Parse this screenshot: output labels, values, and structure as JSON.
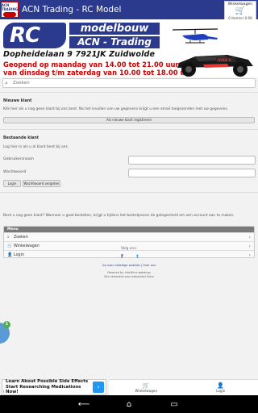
{
  "app": {
    "title": "ACN Trading - RC Model",
    "icon_text": "ACN TRADING"
  },
  "cart_widget": {
    "label": "Winkelwagen",
    "price": "0 item(s) 0,00",
    "icon": "cart-icon"
  },
  "banner": {
    "rc": "RC",
    "modelbouw": "modelbouw",
    "acn": "ACN - Trading",
    "address": "Dopheidelaan 9    7921JK    Zuidwolde",
    "open_line1": "Geopend op maandag van 14.00 tot 21.00 uur",
    "open_line2": "van dinsdag t/m zaterdag van 10.00 tot 18.00 uur",
    "car_text": "OVER X"
  },
  "search": {
    "placeholder": "Zoeken"
  },
  "new_customer": {
    "title": "Nieuwe klant",
    "text": "Klik hier als u nog geen klant bij ons bent. Na het invullen van uw gegevens krijgt u een email toegezonden met uw gegevens.",
    "button": "Als nieuwe klant registreren"
  },
  "existing_customer": {
    "title": "Bestaande klant",
    "text": "Log hier in als u al klant bent bij ons.",
    "username_label": "Gebruikersnaam",
    "password_label": "Wachtwoord",
    "login_button": "Login",
    "forgot_button": "Wachtwoord vergeten"
  },
  "info_text": "Bent u nog geen klant? Wanneer u gaat bestellen, krijgt u tijdens het bestelproces de gelegenheid om een account aan te maken.",
  "menu": {
    "title": "Menu",
    "items": [
      {
        "label": "Zoeken",
        "icon": "search-icon"
      },
      {
        "label": "Winkelwagen",
        "icon": "cart-icon"
      },
      {
        "label": "Login",
        "icon": "user-icon"
      }
    ]
  },
  "footer": {
    "follow": "Volg ons:",
    "facebook": "f",
    "twitter": "t",
    "links": "Ga naar volledige website | Over ons",
    "powered": "Powered by: Intelliline webshop",
    "app_note": "Site verbeterd voor webwinkel Extra"
  },
  "bubble_badge": "1",
  "ad": {
    "line1": "Learn About Possible Side Effects",
    "line2": "Start Researching Medications Now!",
    "arrow": "›",
    "info": "i"
  },
  "tabs": [
    {
      "label": "Winkelwagen",
      "icon": "cart-icon"
    },
    {
      "label": "Login",
      "icon": "user-icon"
    }
  ],
  "nav": {
    "back": "⟵",
    "home": "⌂",
    "recents": "▭"
  }
}
